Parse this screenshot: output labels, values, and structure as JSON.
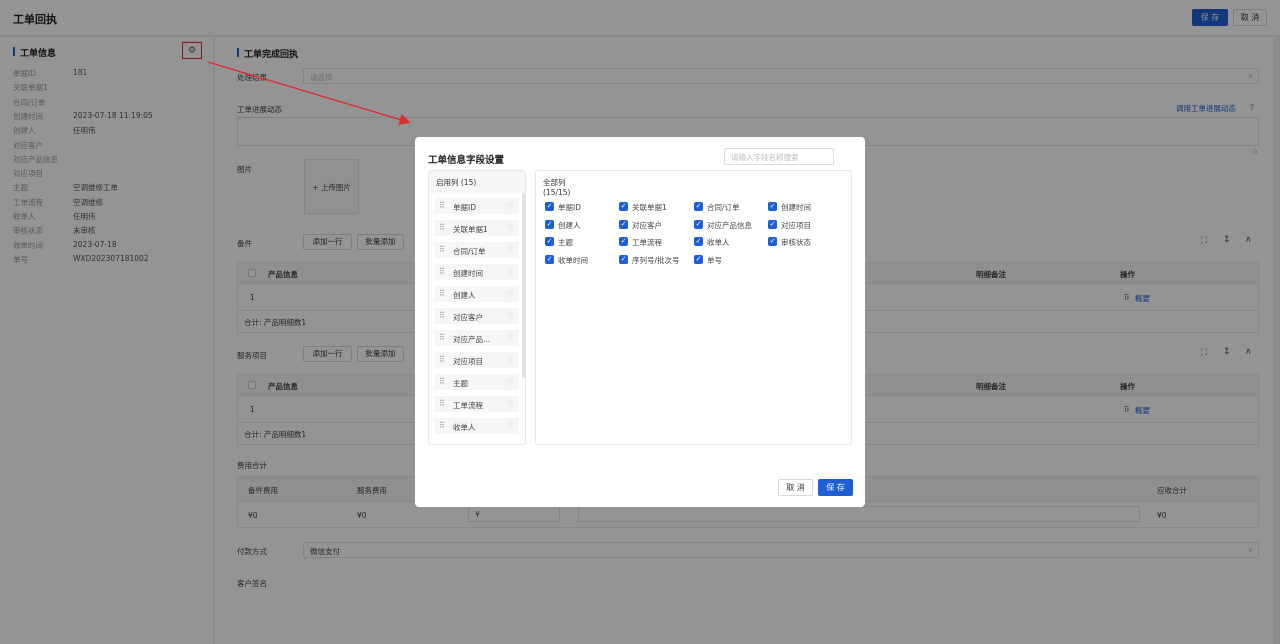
{
  "topbar": {
    "title": "工单回执",
    "save": "保 存",
    "cancel": "取 消"
  },
  "left": {
    "title": "工单信息",
    "rows": [
      {
        "k": "单据ID",
        "v": "181"
      },
      {
        "k": "关联单据1",
        "v": ""
      },
      {
        "k": "合同/订单",
        "v": ""
      },
      {
        "k": "创建时间",
        "v": "2023-07-18 11:19:05"
      },
      {
        "k": "创建人",
        "v": "任明伟"
      },
      {
        "k": "对应客户",
        "v": ""
      },
      {
        "k": "对应产品信息",
        "v": ""
      },
      {
        "k": "对应项目",
        "v": ""
      },
      {
        "k": "主题",
        "v": "空调维修工单"
      },
      {
        "k": "工单流程",
        "v": "空调维修"
      },
      {
        "k": "收单人",
        "v": "任明伟"
      },
      {
        "k": "审核状态",
        "v": "未审核"
      },
      {
        "k": "收单时间",
        "v": "2023-07-18"
      },
      {
        "k": "单号",
        "v": "WXD202307181002"
      }
    ]
  },
  "main": {
    "title": "工单完成回执",
    "result_label": "处理结果",
    "result_placeholder": "请选择",
    "progress_label": "工单进展动态",
    "progress_link": "调用工单进展动态",
    "progress_count": "0",
    "image_label": "图片",
    "upload": "+ 上传图片",
    "parts": {
      "label": "备件",
      "add_row": "添加一行",
      "batch_add": "批量添加",
      "headers": [
        "产品信息",
        "明细备注",
        "操作"
      ],
      "row_index": "1",
      "row_action": "概要",
      "total": "合计: 产品明细数1"
    },
    "service": {
      "label": "服务项目",
      "add_row": "添加一行",
      "batch_add": "批量添加",
      "headers": [
        "产品信息",
        "明细备注",
        "操作"
      ],
      "row_index": "1",
      "row_action": "概要",
      "total": "合计: 产品明细数1"
    },
    "fees": {
      "label": "费用合计",
      "headers": [
        "备件费用",
        "服务费用",
        "应收合计"
      ],
      "values": [
        "¥0",
        "¥0",
        "¥",
        "¥0"
      ]
    },
    "payment_label": "付款方式",
    "payment_value": "微信支付",
    "signature_label": "客户签名"
  },
  "modal": {
    "title": "工单信息字段设置",
    "search_placeholder": "请输入字段名称搜索",
    "enabled_header": "启用列 (15)",
    "all_header": "全部列 (15/15)",
    "enabled": [
      "单据ID",
      "关联单据1",
      "合同/订单",
      "创建时间",
      "创建人",
      "对应客户",
      "对应产品...",
      "对应项目",
      "主题",
      "工单流程",
      "收单人"
    ],
    "all": [
      "单据ID",
      "关联单据1",
      "合同/订单",
      "创建时间",
      "创建人",
      "对应客户",
      "对应产品信息",
      "对应项目",
      "主题",
      "工单流程",
      "收单人",
      "审核状态",
      "收单时间",
      "序列号/批次号",
      "单号"
    ],
    "cancel": "取 消",
    "save": "保 存"
  },
  "colors": {
    "primary": "#1f5fd6",
    "highlight": "#e02b2b"
  }
}
